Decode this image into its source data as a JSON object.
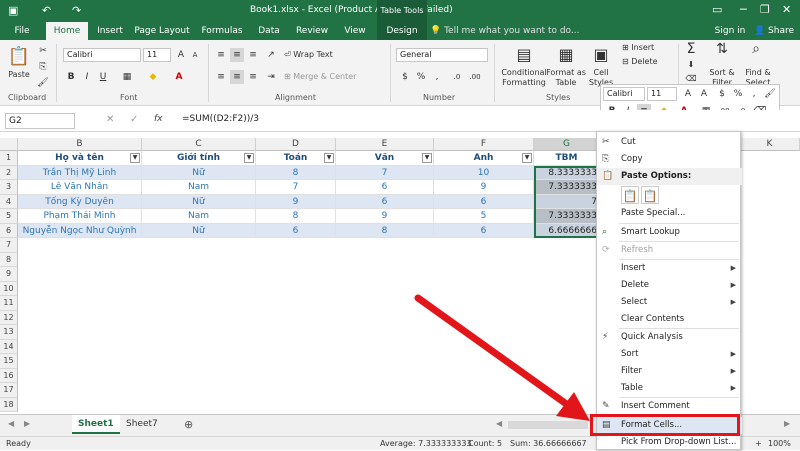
{
  "titlebar": {
    "title": "Book1.xlsx - Excel (Product Activation Failed)",
    "context_tab": "Table Tools",
    "sign_in": "Sign in",
    "share": "Share",
    "min": "─",
    "restore": "❐",
    "close": "✕"
  },
  "tabs": [
    "File",
    "Home",
    "Insert",
    "Page Layout",
    "Formulas",
    "Data",
    "Review",
    "View",
    "Design"
  ],
  "tellme": "Tell me what you want to do...",
  "ribbon": {
    "clipboard": "Clipboard",
    "paste": "Paste",
    "font_group": "Font",
    "font_name": "Calibri",
    "font_size": "11",
    "alignment": "Alignment",
    "wrap": "Wrap Text",
    "merge": "Merge & Center",
    "number_group": "Number",
    "number_format": "General",
    "styles": "Styles",
    "cond": "Conditional Formatting",
    "fmt_table": "Format as Table",
    "cell_styles": "Cell Styles",
    "insert": "Insert",
    "delete": "Delete",
    "format": "Format",
    "sort": "Sort & Filter",
    "find": "Find & Select"
  },
  "minibar": {
    "font": "Calibri",
    "size": "11"
  },
  "formula_bar": {
    "namebox": "G2",
    "fx": "fx",
    "formula": "=SUM((D2:F2))/3"
  },
  "columns": [
    "B",
    "C",
    "D",
    "E",
    "F",
    "G",
    "K"
  ],
  "rows": [
    "1",
    "2",
    "3",
    "4",
    "5",
    "6",
    "7",
    "8",
    "9",
    "10",
    "11",
    "12",
    "13",
    "14",
    "15",
    "16",
    "17",
    "18"
  ],
  "headers": [
    "Họ và tên",
    "Giới tính",
    "Toán",
    "Văn",
    "Anh",
    "TBM"
  ],
  "data": [
    [
      "Trần Thị Mỹ Linh",
      "Nữ",
      "8",
      "7",
      "10",
      "8.3333333"
    ],
    [
      "Lê Văn Nhân",
      "Nam",
      "7",
      "6",
      "9",
      "7.3333333"
    ],
    [
      "Tống Kỳ Duyên",
      "Nữ",
      "9",
      "6",
      "6",
      "7"
    ],
    [
      "Phạm Thái Minh",
      "Nam",
      "8",
      "9",
      "5",
      "7.3333333"
    ],
    [
      "Nguyễn Ngọc Như Quỳnh",
      "Nữ",
      "6",
      "8",
      "6",
      "6.6666666"
    ]
  ],
  "sheets": [
    "Sheet1",
    "Sheet7"
  ],
  "status": {
    "ready": "Ready",
    "average": "Average: 7.333333333",
    "count": "Count: 5",
    "sum": "Sum: 36.66666667",
    "zoom": "100%"
  },
  "menu": {
    "cut": "Cut",
    "copy": "Copy",
    "paste_options": "Paste Options:",
    "paste_special": "Paste Special...",
    "smart_lookup": "Smart Lookup",
    "refresh": "Refresh",
    "insert": "Insert",
    "delete": "Delete",
    "select": "Select",
    "clear": "Clear Contents",
    "quick": "Quick Analysis",
    "sort": "Sort",
    "filter": "Filter",
    "table": "Table",
    "insert_comment": "Insert Comment",
    "format_cells": "Format Cells...",
    "pick": "Pick From Drop-down List..."
  }
}
